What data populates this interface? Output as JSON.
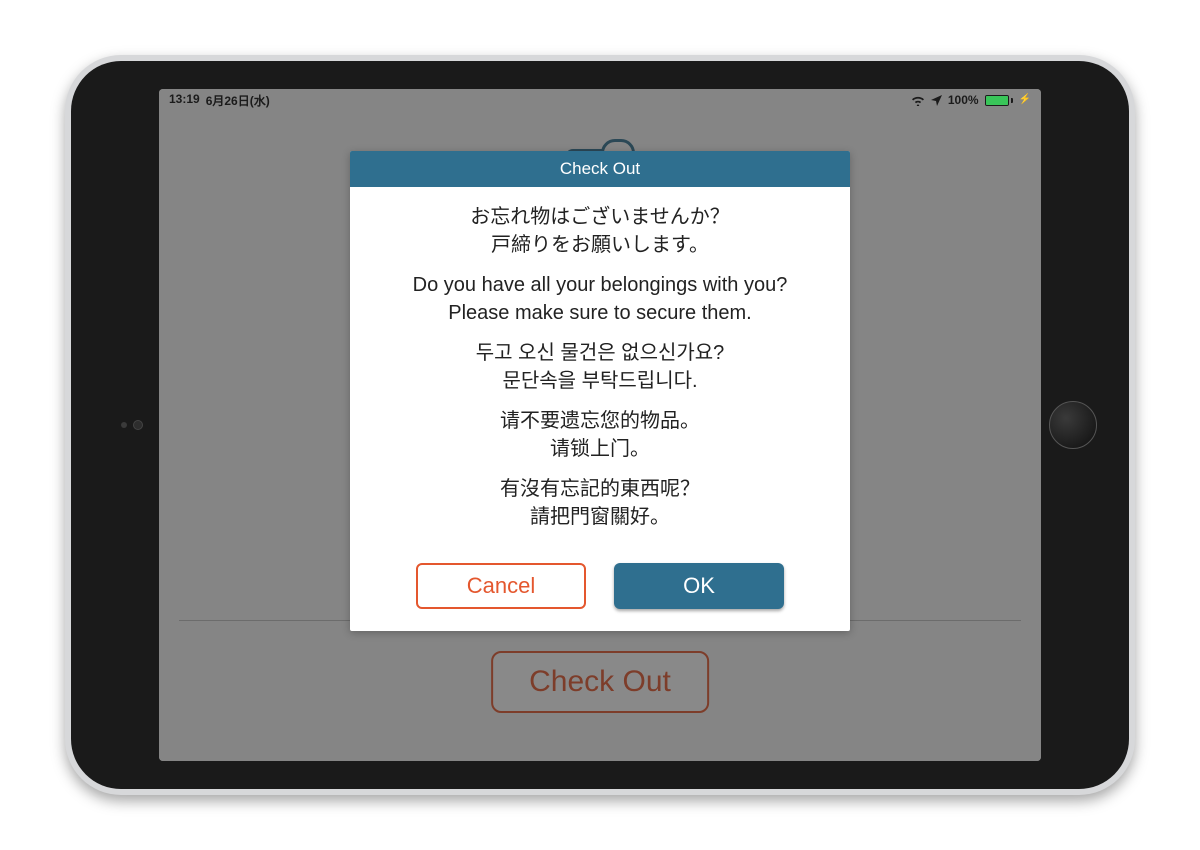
{
  "status": {
    "time": "13:19",
    "date": "6月26日(水)",
    "battery_pct": "100%"
  },
  "background": {
    "checkout_label": "Check Out"
  },
  "modal": {
    "title": "Check Out",
    "messages": {
      "ja": "お忘れ物はございませんか？\n戸締りをお願いします。",
      "en": "Do you have all your belongings with you?\nPlease make sure to secure them.",
      "ko": "두고 오신 물건은 없으신가요?\n문단속을 부탁드립니다.",
      "zh_cn": "请不要遗忘您的物品。\n请锁上门。",
      "zh_tw": "有沒有忘記的東西呢？\n請把門窗關好。"
    },
    "cancel_label": "Cancel",
    "ok_label": "OK"
  },
  "colors": {
    "accent": "#2f6f8f",
    "danger": "#e4572e",
    "battery_green": "#39c559"
  }
}
